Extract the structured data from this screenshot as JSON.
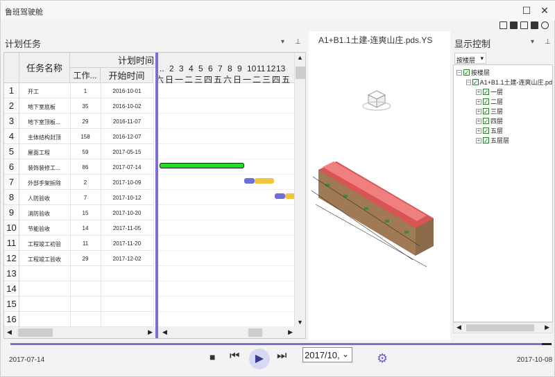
{
  "app": {
    "title": "鲁班驾驶舱"
  },
  "panels": {
    "plan_title": "计划任务",
    "display_title": "显示控制",
    "pin": "⊥",
    "dropdown": "▾"
  },
  "table": {
    "col_name": "任务名称",
    "col_group": "计划时间",
    "col_work": "工作...",
    "col_start": "开始时间",
    "rows": [
      {
        "n": "1",
        "name": "开工",
        "work": "1",
        "start": "2016-10-01"
      },
      {
        "n": "2",
        "name": "地下室底板",
        "work": "35",
        "start": "2016-10-02"
      },
      {
        "n": "3",
        "name": "地下室顶板...",
        "work": "29",
        "start": "2016-11-07"
      },
      {
        "n": "4",
        "name": "主体结构封顶",
        "work": "158",
        "start": "2016-12-07"
      },
      {
        "n": "5",
        "name": "屋面工程",
        "work": "59",
        "start": "2017-05-15"
      },
      {
        "n": "6",
        "name": "装饰装修工...",
        "work": "86",
        "start": "2017-07-14"
      },
      {
        "n": "7",
        "name": "外部手架拆除",
        "work": "2",
        "start": "2017-10-09"
      },
      {
        "n": "8",
        "name": "人防验收",
        "work": "7",
        "start": "2017-10-12"
      },
      {
        "n": "9",
        "name": "消防验收",
        "work": "15",
        "start": "2017-10-20"
      },
      {
        "n": "10",
        "name": "节能验收",
        "work": "14",
        "start": "2017-11-05"
      },
      {
        "n": "11",
        "name": "工程竣工初验",
        "work": "11",
        "start": "2017-11-20"
      },
      {
        "n": "12",
        "name": "工程竣工验收",
        "work": "29",
        "start": "2017-12-02"
      },
      {
        "n": "13",
        "name": "",
        "work": "",
        "start": ""
      },
      {
        "n": "14",
        "name": "",
        "work": "",
        "start": ""
      },
      {
        "n": "15",
        "name": "",
        "work": "",
        "start": ""
      },
      {
        "n": "16",
        "name": "",
        "work": "",
        "start": ""
      }
    ]
  },
  "gantt": {
    "days": [
      "..",
      "2",
      "3",
      "4",
      "5",
      "6",
      "7",
      "8",
      "9",
      "10",
      "11",
      "12",
      "13"
    ],
    "weekdays": [
      "六",
      "日",
      "一",
      "二",
      "三",
      "四",
      "五",
      "六",
      "日",
      "一",
      "二",
      "三",
      "四",
      "五"
    ]
  },
  "model": {
    "file_name": "A1+B1.1土建-连爽山庄.pds.YS"
  },
  "tree": {
    "filter": "按楼层",
    "root": "按楼层",
    "file": "A1+B1.1土建-连爽山庄.pds",
    "floors": [
      "一层",
      "二层",
      "三层",
      "四层",
      "五层",
      "五层层"
    ]
  },
  "playback": {
    "start_date": "2017-07-14",
    "end_date": "2017-10-08",
    "current_date": "2017/10,"
  },
  "colors": {
    "accent": "#7b6fd6",
    "bar_green": "#22dd22",
    "bar_yellow": "#f2c53d"
  }
}
